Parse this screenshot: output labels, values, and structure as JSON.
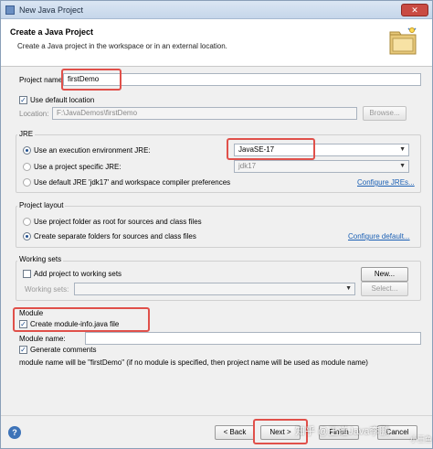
{
  "window": {
    "title": "New Java Project",
    "close_glyph": "✕"
  },
  "banner": {
    "title": "Create a Java Project",
    "description": "Create a Java project in the workspace or in an external location.",
    "icon": "folder-new-project-icon"
  },
  "project": {
    "name_label": "Project name:",
    "name_value": "firstDemo",
    "use_default_location_label": "Use default location",
    "use_default_location_checked": true,
    "location_label": "Location:",
    "location_value": "F:\\JavaDemos\\firstDemo",
    "browse_label": "Browse..."
  },
  "jre": {
    "section_title": "JRE",
    "option_exec_env_label": "Use an execution environment JRE:",
    "option_exec_env_value": "JavaSE-17",
    "option_specific_label": "Use a project specific JRE:",
    "option_specific_value": "jdk17",
    "option_default_label": "Use default JRE 'jdk17' and workspace compiler preferences",
    "configure_link": "Configure JREs..."
  },
  "layout": {
    "section_title": "Project layout",
    "option_root_label": "Use project folder as root for sources and class files",
    "option_separate_label": "Create separate folders for sources and class files",
    "configure_link": "Configure default..."
  },
  "working_sets": {
    "section_title": "Working sets",
    "add_label": "Add project to working sets",
    "new_button": "New...",
    "sets_label": "Working sets:",
    "select_button": "Select..."
  },
  "module": {
    "section_title": "Module",
    "create_module_info_label": "Create module-info.java file",
    "module_name_label": "Module name:",
    "module_name_value": "",
    "generate_comments_label": "Generate comments",
    "info_text": "module name will be \"firstDemo\"  (if no module is specified, then project name will be used as module name)"
  },
  "footer": {
    "help_glyph": "?",
    "back_button": "< Back",
    "next_button": "Next >",
    "finish_button": "Finish",
    "cancel_button": "Cancel"
  },
  "watermark": {
    "text": "知乎 @王道Java李鹏",
    "corner_text": "小王鱼"
  },
  "colors": {
    "highlight": "#e0504a",
    "link": "#1a5fb4",
    "accent": "#1f4f8f"
  }
}
